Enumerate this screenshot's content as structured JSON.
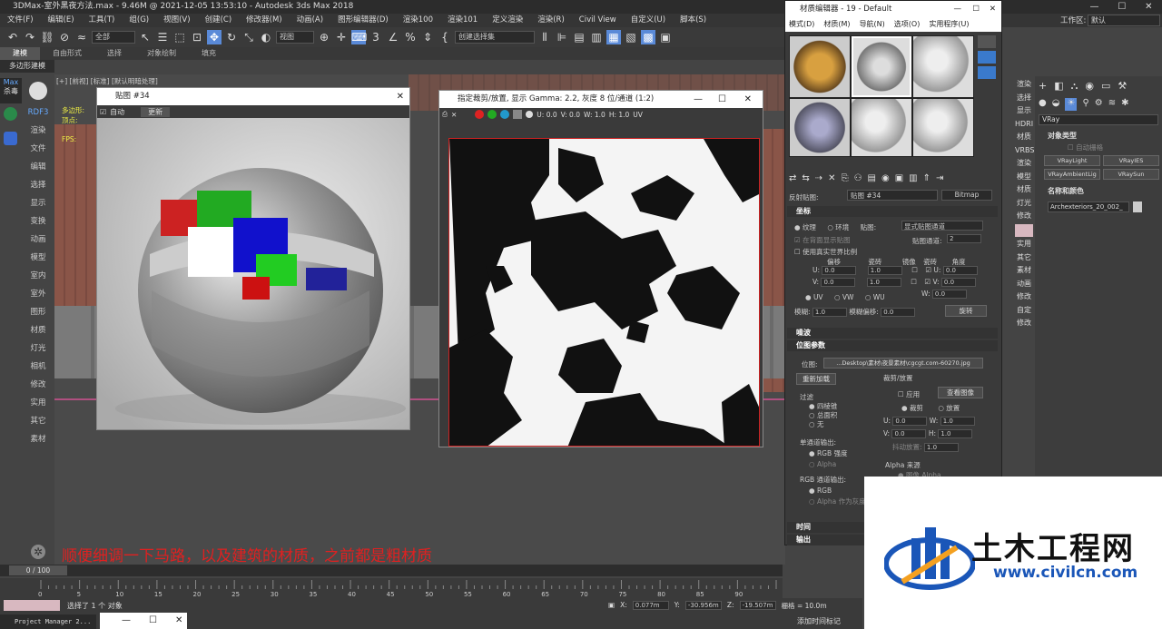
{
  "app": {
    "title": "3DMax-室外黑夜方法.max - 9.46M @ 2021-12-05 13:53:10 - Autodesk 3ds Max 2018",
    "workspace_label": "工作区:",
    "workspace_value": "默认"
  },
  "menu": [
    "文件(F)",
    "编辑(E)",
    "工具(T)",
    "组(G)",
    "视图(V)",
    "创建(C)",
    "修改器(M)",
    "动画(A)",
    "图形编辑器(D)",
    "渲染100",
    "渲染101",
    "定义渲染",
    "渲染(R)",
    "Civil View",
    "自定义(U)",
    "脚本(S)"
  ],
  "toolbar": {
    "select_filter": "全部",
    "view_ref": "视图",
    "selection_set": "创建选择集"
  },
  "ribbon": [
    "建模",
    "自由形式",
    "选择",
    "对象绘制",
    "填充"
  ],
  "subribbon": "多边形建模",
  "left_panel": {
    "brand": "Max",
    "brand2": "杀毒",
    "items": [
      "RDF3",
      "渲染",
      "文件",
      "编辑",
      "选择",
      "显示",
      "变换",
      "动画",
      "模型",
      "室内",
      "室外",
      "图形",
      "材质",
      "灯光",
      "相机",
      "修改",
      "实用",
      "其它",
      "素材"
    ]
  },
  "viewport": {
    "label": "[+] [前视] [标准] [默认明暗处理]",
    "side_labels": [
      "多边形:",
      "顶点:",
      "FPS:"
    ]
  },
  "map_window": {
    "title": "贴图 #34",
    "auto_label": "自动",
    "update_label": "更新"
  },
  "bitmap_window": {
    "title": "指定裁剪/放置, 显示 Gamma: 2.2, 灰度 8 位/通道 (1:2)",
    "u": "U: 0.0",
    "v": "V: 0.0",
    "w": "W: 1.0",
    "h": "H: 1.0",
    "uv": "UV"
  },
  "material_editor": {
    "title": "材质编辑器 - 19 - Default",
    "menu": [
      "模式(D)",
      "材质(M)",
      "导航(N)",
      "选项(O)",
      "实用程序(U)"
    ],
    "map_label": "反射贴图:",
    "map_name": "贴图 #34",
    "map_type": "Bitmap",
    "coords_title": "坐标",
    "texture_label": "纹理",
    "env_label": "环境",
    "mapping_label": "贴图:",
    "mapping_value": "显式贴图通道",
    "show_back": "在背面显示贴图",
    "map_channel_label": "贴图通道:",
    "map_channel": "2",
    "real_world": "使用真实世界比例",
    "col_offset": "偏移",
    "col_tiling": "瓷砖",
    "col_mirror": "镜像",
    "col_tile": "瓷砖",
    "col_angle": "角度",
    "u_offset": "0.0",
    "u_tiling": "1.0",
    "u_angle": "0.0",
    "v_offset": "0.0",
    "v_tiling": "1.0",
    "v_angle": "0.0",
    "w_angle": "0.0",
    "uv": "UV",
    "vw": "VW",
    "wu": "WU",
    "blur_label": "模糊:",
    "blur": "1.0",
    "blur_offset_label": "模糊偏移:",
    "blur_offset": "0.0",
    "rotate_label": "旋转",
    "noise_title": "噪波",
    "bitmap_params_title": "位图参数",
    "bitmap_label": "位图:",
    "bitmap_path": "...Desktop\\素材\\夜景素材\\cgcgt.com-60270.jpg",
    "reload": "重新加载",
    "crop_title": "裁剪/放置",
    "apply": "应用",
    "view_image": "查看图像",
    "crop": "裁剪",
    "place": "放置",
    "cu": "0.0",
    "cw": "1.0",
    "cv": "0.0",
    "ch": "1.0",
    "jitter_label": "抖动放置:",
    "jitter": "1.0",
    "filter_title": "过滤",
    "filter_opts": [
      "四棱锥",
      "总面积",
      "无"
    ],
    "mono_title": "单通道输出:",
    "mono_rgb": "RGB 强度",
    "mono_alpha": "Alpha",
    "rgb_title": "RGB 通道输出:",
    "rgb_rgb": "RGB",
    "rgb_alpha": "Alpha 作为灰度",
    "alpha_title": "Alpha 来源",
    "alpha_img": "图像 Alpha",
    "time_title": "时间",
    "output_title": "输出"
  },
  "cmd_panel": {
    "dropdown": "VRay",
    "obj_type_title": "对象类型",
    "auto_grid": "自动栅格",
    "buttons": [
      "VRayLight",
      "VRayIES",
      "VRayAmbientLig",
      "VRaySun"
    ],
    "name_color_title": "名称和颜色",
    "object_name": "Archexteriors_20_002_"
  },
  "right_strip": [
    "渲染",
    "选择",
    "显示",
    "HDRI",
    "材质",
    "VRBS",
    "渲染",
    "模型",
    "材质",
    "灯光",
    "修改",
    "",
    "实用",
    "其它",
    "素材",
    "动画",
    "修改",
    "自定",
    "修改"
  ],
  "caption": "顺便细调一下马路，以及建筑的材质，之前都是粗材质",
  "timeline": {
    "frame": "0 / 100",
    "ticks": [
      "0",
      "5",
      "10",
      "15",
      "20",
      "25",
      "30",
      "35",
      "40",
      "45",
      "50",
      "55",
      "60",
      "65",
      "70",
      "75",
      "80",
      "85",
      "90"
    ]
  },
  "status": {
    "selected": "选择了 1 个 对象",
    "x": "0.077m",
    "y": "-30.956m",
    "z": "-19.507m",
    "grid": "栅格 = 10.0m",
    "add_key": "添加时间标记",
    "project_mgr": "Project Manager 2..."
  },
  "logo": {
    "text_cn": "土木工程网",
    "url": "www.civilcn.com"
  }
}
